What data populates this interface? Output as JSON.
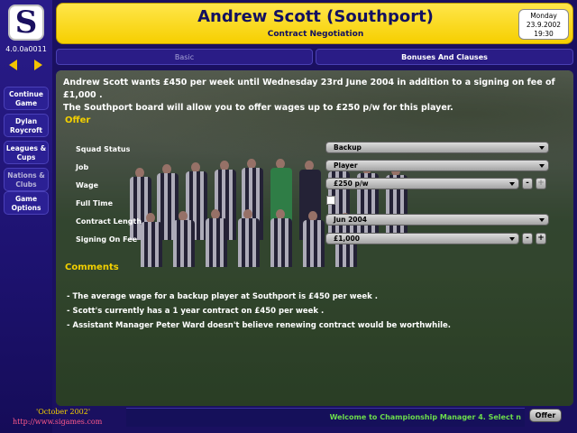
{
  "sidebar": {
    "version": "4.0.0a0011",
    "buttons": [
      "Continue Game",
      "Dylan Roycroft",
      "Leagues & Cups",
      "Nations & Clubs",
      "Game Options"
    ]
  },
  "header": {
    "title": "Andrew Scott (Southport)",
    "subtitle": "Contract Negotiation",
    "date": {
      "day": "Monday",
      "date": "23.9.2002",
      "time": "19:30"
    }
  },
  "tabs": [
    {
      "label": "Basic",
      "active": false
    },
    {
      "label": "Bonuses And Clauses",
      "active": true
    }
  ],
  "main": {
    "intro_line1": "Andrew Scott wants £450 per week until Wednesday 23rd June 2004 in addition to a signing on fee of £1,000 .",
    "intro_line2": "The Southport board will allow you to offer wages up to £250 p/w for this player.",
    "offer_heading": "Offer",
    "fields": {
      "squad_status": {
        "label": "Squad Status",
        "value": "Backup"
      },
      "job": {
        "label": "Job",
        "value": "Player"
      },
      "wage": {
        "label": "Wage",
        "value": "£250 p/w"
      },
      "full_time": {
        "label": "Full Time",
        "checked": false
      },
      "contract_length": {
        "label": "Contract Length",
        "value": "Jun 2004"
      },
      "signing_on_fee": {
        "label": "Signing On Fee",
        "value": "£1,000"
      }
    },
    "comments_heading": "Comments",
    "comments": [
      "- The average wage for a backup player at Southport is £450 per week .",
      "- Scott's currently has a 1 year contract on £450 per week .",
      "- Assistant Manager Peter Ward doesn't believe renewing contract would be worthwhile."
    ]
  },
  "footer": {
    "date_text": "'October 2002'",
    "url": "http://www.sigames.com",
    "news": "Welcome to Championship Manager 4. Select n",
    "offer_button": "Offer"
  },
  "colors": {
    "accent_yellow": "#f6cf00",
    "background_navy": "#1a1060",
    "news_green": "#6cdc4c"
  }
}
